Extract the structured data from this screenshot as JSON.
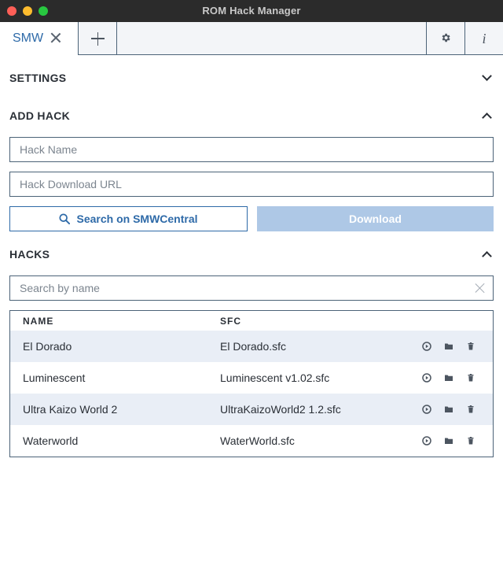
{
  "window": {
    "title": "ROM Hack Manager"
  },
  "tabs": {
    "active_label": "SMW",
    "info_label": "i"
  },
  "sections": {
    "settings": {
      "title": "SETTINGS",
      "state": "collapsed"
    },
    "add_hack": {
      "title": "ADD HACK",
      "state": "expanded",
      "name_placeholder": "Hack Name",
      "url_placeholder": "Hack Download URL",
      "search_button": "Search on SMWCentral",
      "download_button": "Download"
    },
    "hacks": {
      "title": "HACKS",
      "state": "expanded",
      "search_placeholder": "Search by name",
      "columns": {
        "name": "NAME",
        "sfc": "SFC"
      },
      "rows": [
        {
          "name": "El Dorado",
          "sfc": "El Dorado.sfc"
        },
        {
          "name": "Luminescent",
          "sfc": "Luminescent v1.02.sfc"
        },
        {
          "name": "Ultra Kaizo World 2",
          "sfc": "UltraKaizoWorld2 1.2.sfc"
        },
        {
          "name": "Waterworld",
          "sfc": "WaterWorld.sfc"
        }
      ],
      "row_actions": [
        "play-icon",
        "folder-icon",
        "trash-icon"
      ]
    }
  },
  "colors": {
    "accent": "#2e6aa8",
    "border": "#4c6378",
    "disabled_button": "#aec8e6",
    "alt_row": "#e9eef6"
  }
}
